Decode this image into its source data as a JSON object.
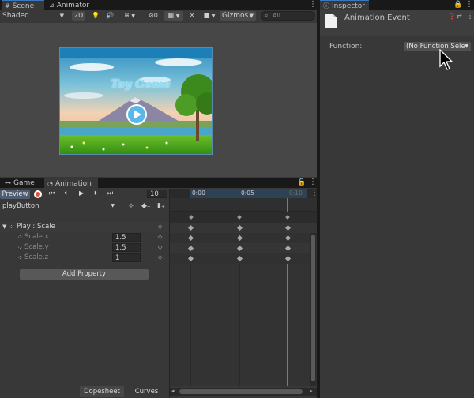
{
  "scene_panel": {
    "tabs": [
      {
        "label": "Scene",
        "icon": "scene-hash-icon",
        "active": true
      },
      {
        "label": "Animator",
        "icon": "animator-icon",
        "active": false
      }
    ],
    "shading_mode": "Shaded",
    "btn_2d": "2D",
    "hidden_count": "0",
    "gizmos": "Gizmos",
    "search_placeholder": "All"
  },
  "game_screen": {
    "title": "Toy Game"
  },
  "animation_panel": {
    "tabs": [
      {
        "label": "Game",
        "icon": "gamepad-icon",
        "active": false
      },
      {
        "label": "Animation",
        "icon": "animation-clock-icon",
        "active": true
      }
    ],
    "preview_label": "Preview",
    "frame_value": "10",
    "clip_name": "playButton",
    "property_group": "Play : Scale",
    "properties": [
      {
        "name": "Scale.x",
        "value": "1.5"
      },
      {
        "name": "Scale.y",
        "value": "1.5"
      },
      {
        "name": "Scale.z",
        "value": "1"
      }
    ],
    "add_property": "Add Property",
    "timeline_ticks": [
      "0:00",
      "0:05",
      "0:10"
    ],
    "bottom_tabs": [
      "Dopesheet",
      "Curves"
    ]
  },
  "inspector": {
    "tab_label": "Inspector",
    "tab_icon": "info-icon",
    "title": "Animation Event",
    "function_label": "Function:",
    "function_value": "(No Function Sele"
  },
  "colors": {
    "accent_blue": "#3a79bb",
    "record_red": "#e2553a",
    "panel_bg": "#383838"
  }
}
